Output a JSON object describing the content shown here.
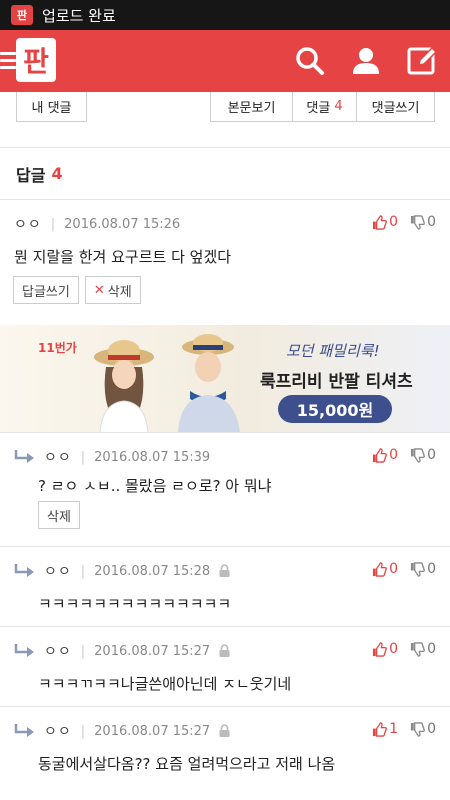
{
  "status_bar": {
    "notification": "업로드 완료",
    "app_icon": "pann-app-icon"
  },
  "header": {
    "logo_text": "판",
    "icons": [
      "menu-icon",
      "search-icon",
      "user-icon",
      "write-icon"
    ],
    "accent_color": "#e64444"
  },
  "tabs": {
    "my_comments": "내 댓글",
    "view_body": "본문보기",
    "comments_label": "댓글",
    "comments_count": "4",
    "write_comment": "댓글쓰기"
  },
  "reply_section": {
    "label": "답글",
    "count": "4"
  },
  "comment_main": {
    "author": "ㅇㅇ",
    "timestamp": "2016.08.07 15:26",
    "text": "뭔 지랄을 한겨 요구르트 다 엎겠다",
    "up": "0",
    "down": "0",
    "reply_button": "답글쓰기",
    "delete_button": "삭제"
  },
  "ad": {
    "brand": "11번가",
    "tagline": "모던 패밀리룩!",
    "title": "룩프리비 반팔 티셔츠",
    "price": "15,000원"
  },
  "replies": [
    {
      "author": "ㅇㅇ",
      "timestamp": "2016.08.07 15:39",
      "text": "? ㄹㅇ ㅅㅂ.. 몰랐음 ㄹㅇ로? 아 뭐냐",
      "up": "0",
      "down": "0",
      "delete_button": "삭제",
      "locked": false
    },
    {
      "author": "ㅇㅇ",
      "timestamp": "2016.08.07 15:28",
      "text": "ㅋㅋㅋㅋㅋㅋㅋㅋㅋㅋㅋㅋㅋㅋ",
      "up": "0",
      "down": "0",
      "locked": true
    },
    {
      "author": "ㅇㅇ",
      "timestamp": "2016.08.07 15:27",
      "text": "ㅋㅋㅋㄲㅋㅋ나글쓴애아닌데 ㅈㄴ웃기네",
      "up": "0",
      "down": "0",
      "locked": true
    },
    {
      "author": "ㅇㅇ",
      "timestamp": "2016.08.07 15:27",
      "text": "동굴에서살다옴?? 요즘 얼려먹으라고 저래 나옴",
      "up": "1",
      "down": "0",
      "locked": true
    }
  ]
}
